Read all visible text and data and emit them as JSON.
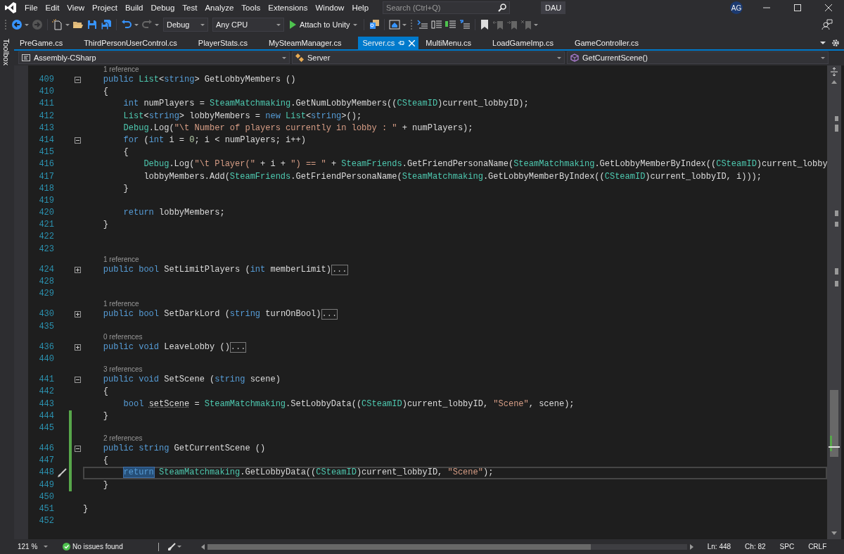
{
  "menu_bar": {
    "items": [
      "File",
      "Edit",
      "View",
      "Project",
      "Build",
      "Debug",
      "Test",
      "Analyze",
      "Tools",
      "Extensions",
      "Window",
      "Help"
    ],
    "search": {
      "placeholder": "Search (Ctrl+Q)"
    },
    "solution_name": "DAU",
    "avatar": "AG"
  },
  "toolbar": {
    "configuration": "Debug",
    "platform": "Any CPU",
    "start_button": "Attach to Unity"
  },
  "side_panel": {
    "label": "Toolbox"
  },
  "tabs": [
    {
      "label": "PreGame.cs",
      "selected": false,
      "pinned": false
    },
    {
      "label": "ThirdPersonUserControl.cs",
      "selected": false,
      "pinned": false
    },
    {
      "label": "PlayerStats.cs",
      "selected": false,
      "pinned": false
    },
    {
      "label": "MySteamManager.cs",
      "selected": false,
      "pinned": false
    },
    {
      "label": "Server.cs",
      "selected": true,
      "pinned": true
    },
    {
      "label": "MultiMenu.cs",
      "selected": false,
      "pinned": false
    },
    {
      "label": "LoadGameImp.cs",
      "selected": false,
      "pinned": false
    },
    {
      "label": "GameController.cs",
      "selected": false,
      "pinned": false
    }
  ],
  "navigation_bar": {
    "project": "Assembly-CSharp",
    "type": "Server",
    "member": "GetCurrentScene()"
  },
  "editor": {
    "lines": [
      {
        "number": "409",
        "lens": "1 reference",
        "fold_box": {
          "expanded": true
        },
        "changed": false,
        "current": false,
        "tokens": [
          {
            "kind": "keyword",
            "text": "    public "
          },
          {
            "kind": "type",
            "text": "List"
          },
          {
            "kind": "text",
            "text": "<"
          },
          {
            "kind": "keyword",
            "text": "string"
          },
          {
            "kind": "text",
            "text": "> GetLobbyMembers ()"
          }
        ]
      },
      {
        "number": "410",
        "changed": false,
        "current": false,
        "tokens": [
          {
            "kind": "text",
            "text": "    {"
          }
        ]
      },
      {
        "number": "411",
        "changed": false,
        "current": false,
        "tokens": [
          {
            "kind": "keyword",
            "text": "        int"
          },
          {
            "kind": "text",
            "text": " numPlayers = "
          },
          {
            "kind": "type",
            "text": "SteamMatchmaking"
          },
          {
            "kind": "text",
            "text": ".GetNumLobbyMembers(("
          },
          {
            "kind": "type",
            "text": "CSteamID"
          },
          {
            "kind": "text",
            "text": ")current_lobbyID);"
          }
        ]
      },
      {
        "number": "412",
        "changed": false,
        "current": false,
        "tokens": [
          {
            "kind": "type",
            "text": "        List"
          },
          {
            "kind": "text",
            "text": "<"
          },
          {
            "kind": "keyword",
            "text": "string"
          },
          {
            "kind": "text",
            "text": "> lobbyMembers = "
          },
          {
            "kind": "keyword",
            "text": "new "
          },
          {
            "kind": "type",
            "text": "List"
          },
          {
            "kind": "text",
            "text": "<"
          },
          {
            "kind": "keyword",
            "text": "string"
          },
          {
            "kind": "text",
            "text": ">();"
          }
        ]
      },
      {
        "number": "413",
        "changed": false,
        "current": false,
        "tokens": [
          {
            "kind": "type",
            "text": "        Debug"
          },
          {
            "kind": "text",
            "text": ".Log("
          },
          {
            "kind": "string",
            "text": "\"\\t Number of players currently in lobby : \""
          },
          {
            "kind": "text",
            "text": " + numPlayers);"
          }
        ]
      },
      {
        "number": "414",
        "fold_box": {
          "expanded": true
        },
        "changed": false,
        "current": false,
        "tokens": [
          {
            "kind": "keyword",
            "text": "        for"
          },
          {
            "kind": "text",
            "text": " ("
          },
          {
            "kind": "keyword",
            "text": "int"
          },
          {
            "kind": "text",
            "text": " i = "
          },
          {
            "kind": "number",
            "text": "0"
          },
          {
            "kind": "text",
            "text": "; i < numPlayers; i++)"
          }
        ]
      },
      {
        "number": "415",
        "changed": false,
        "current": false,
        "tokens": [
          {
            "kind": "text",
            "text": "        {"
          }
        ]
      },
      {
        "number": "416",
        "changed": false,
        "current": false,
        "tokens": [
          {
            "kind": "type",
            "text": "            Debug"
          },
          {
            "kind": "text",
            "text": ".Log("
          },
          {
            "kind": "string",
            "text": "\"\\t Player(\""
          },
          {
            "kind": "text",
            "text": " + i + "
          },
          {
            "kind": "string",
            "text": "\") == \""
          },
          {
            "kind": "text",
            "text": " + "
          },
          {
            "kind": "type",
            "text": "SteamFriends"
          },
          {
            "kind": "text",
            "text": ".GetFriendPersonaName("
          },
          {
            "kind": "type",
            "text": "SteamMatchmaking"
          },
          {
            "kind": "text",
            "text": ".GetLobbyMemberByIndex(("
          },
          {
            "kind": "type",
            "text": "CSteamID"
          },
          {
            "kind": "text",
            "text": ")current_lobby"
          }
        ]
      },
      {
        "number": "417",
        "changed": false,
        "current": false,
        "tokens": [
          {
            "kind": "text",
            "text": "            lobbyMembers.Add("
          },
          {
            "kind": "type",
            "text": "SteamFriends"
          },
          {
            "kind": "text",
            "text": ".GetFriendPersonaName("
          },
          {
            "kind": "type",
            "text": "SteamMatchmaking"
          },
          {
            "kind": "text",
            "text": ".GetLobbyMemberByIndex(("
          },
          {
            "kind": "type",
            "text": "CSteamID"
          },
          {
            "kind": "text",
            "text": ")current_lobbyID, i)));"
          }
        ]
      },
      {
        "number": "418",
        "changed": false,
        "current": false,
        "tokens": [
          {
            "kind": "text",
            "text": "        }"
          }
        ]
      },
      {
        "number": "419",
        "changed": false,
        "current": false
      },
      {
        "number": "420",
        "changed": false,
        "current": false,
        "tokens": [
          {
            "kind": "keyword",
            "text": "        return"
          },
          {
            "kind": "text",
            "text": " lobbyMembers;"
          }
        ]
      },
      {
        "number": "421",
        "changed": false,
        "current": false,
        "tokens": [
          {
            "kind": "text",
            "text": "    }"
          }
        ]
      },
      {
        "number": "422",
        "changed": false,
        "current": false
      },
      {
        "number": "423",
        "changed": false,
        "current": false
      },
      {
        "number": "424",
        "lens": "1 reference",
        "fold_box": {
          "expanded": false
        },
        "changed": false,
        "current": false,
        "tokens": [
          {
            "kind": "keyword",
            "text": "    public bool"
          },
          {
            "kind": "text",
            "text": " SetLimitPlayers ("
          },
          {
            "kind": "keyword",
            "text": "int"
          },
          {
            "kind": "text",
            "text": " memberLimit)"
          },
          {
            "kind": "collapsed",
            "text": "..."
          }
        ]
      },
      {
        "number": "428",
        "changed": false,
        "current": false
      },
      {
        "number": "429",
        "changed": false,
        "current": false
      },
      {
        "number": "430",
        "lens": "1 reference",
        "fold_box": {
          "expanded": false
        },
        "changed": false,
        "current": false,
        "tokens": [
          {
            "kind": "keyword",
            "text": "    public bool"
          },
          {
            "kind": "text",
            "text": " SetDarkLord ("
          },
          {
            "kind": "keyword",
            "text": "string"
          },
          {
            "kind": "text",
            "text": " turnOnBool)"
          },
          {
            "kind": "collapsed",
            "text": "..."
          }
        ]
      },
      {
        "number": "435",
        "changed": false,
        "current": false
      },
      {
        "number": "436",
        "lens": "0 references",
        "fold_box": {
          "expanded": false
        },
        "changed": false,
        "current": false,
        "tokens": [
          {
            "kind": "keyword",
            "text": "    public void"
          },
          {
            "kind": "text",
            "text": " LeaveLobby ()"
          },
          {
            "kind": "collapsed",
            "text": "..."
          }
        ]
      },
      {
        "number": "440",
        "changed": false,
        "current": false
      },
      {
        "number": "441",
        "lens": "3 references",
        "fold_box": {
          "expanded": true
        },
        "changed": false,
        "current": false,
        "tokens": [
          {
            "kind": "keyword",
            "text": "    public void"
          },
          {
            "kind": "text",
            "text": " SetScene ("
          },
          {
            "kind": "keyword",
            "text": "string"
          },
          {
            "kind": "text",
            "text": " scene)"
          }
        ]
      },
      {
        "number": "442",
        "changed": false,
        "current": false,
        "tokens": [
          {
            "kind": "text",
            "text": "    {"
          }
        ]
      },
      {
        "number": "443",
        "changed": false,
        "current": false,
        "tokens": [
          {
            "kind": "keyword",
            "text": "        bool "
          },
          {
            "kind": "hinted",
            "text": "setScene"
          },
          {
            "kind": "text",
            "text": " = "
          },
          {
            "kind": "type",
            "text": "SteamMatchmaking"
          },
          {
            "kind": "text",
            "text": ".SetLobbyData(("
          },
          {
            "kind": "type",
            "text": "CSteamID"
          },
          {
            "kind": "text",
            "text": ")current_lobbyID, "
          },
          {
            "kind": "string",
            "text": "\"Scene\""
          },
          {
            "kind": "text",
            "text": ", scene);"
          }
        ]
      },
      {
        "number": "444",
        "changed": true,
        "current": false,
        "tokens": [
          {
            "kind": "text",
            "text": "    }"
          }
        ]
      },
      {
        "number": "445",
        "changed": true,
        "current": false
      },
      {
        "number": "446",
        "lens": "2 references",
        "fold_box": {
          "expanded": true
        },
        "changed": true,
        "current": false,
        "tokens": [
          {
            "kind": "keyword",
            "text": "    public string"
          },
          {
            "kind": "text",
            "text": " GetCurrentScene ()"
          }
        ]
      },
      {
        "number": "447",
        "changed": true,
        "current": false,
        "tokens": [
          {
            "kind": "text",
            "text": "    {"
          }
        ]
      },
      {
        "number": "448",
        "changed": true,
        "current": true,
        "tokens": [
          {
            "kind": "selected",
            "text": "        return"
          },
          {
            "kind": "type",
            "text": " SteamMatchmaking"
          },
          {
            "kind": "text",
            "text": ".GetLobbyData(("
          },
          {
            "kind": "type",
            "text": "CSteamID"
          },
          {
            "kind": "text",
            "text": ")current_lobbyID, "
          },
          {
            "kind": "string",
            "text": "\"Scene\""
          },
          {
            "kind": "text",
            "text": ");"
          }
        ]
      },
      {
        "number": "449",
        "changed": true,
        "current": false,
        "tokens": [
          {
            "kind": "text",
            "text": "    }"
          }
        ]
      },
      {
        "number": "450",
        "changed": false,
        "current": false
      },
      {
        "number": "451",
        "changed": false,
        "current": false,
        "tokens": [
          {
            "kind": "text",
            "text": "}"
          }
        ]
      },
      {
        "number": "452",
        "changed": false,
        "current": false
      }
    ]
  },
  "status_bar": {
    "zoom": "121 %",
    "issues": "No issues found",
    "line": "Ln: 448",
    "column": "Ch: 82",
    "indent": "SPC",
    "line_ending": "CRLF"
  }
}
